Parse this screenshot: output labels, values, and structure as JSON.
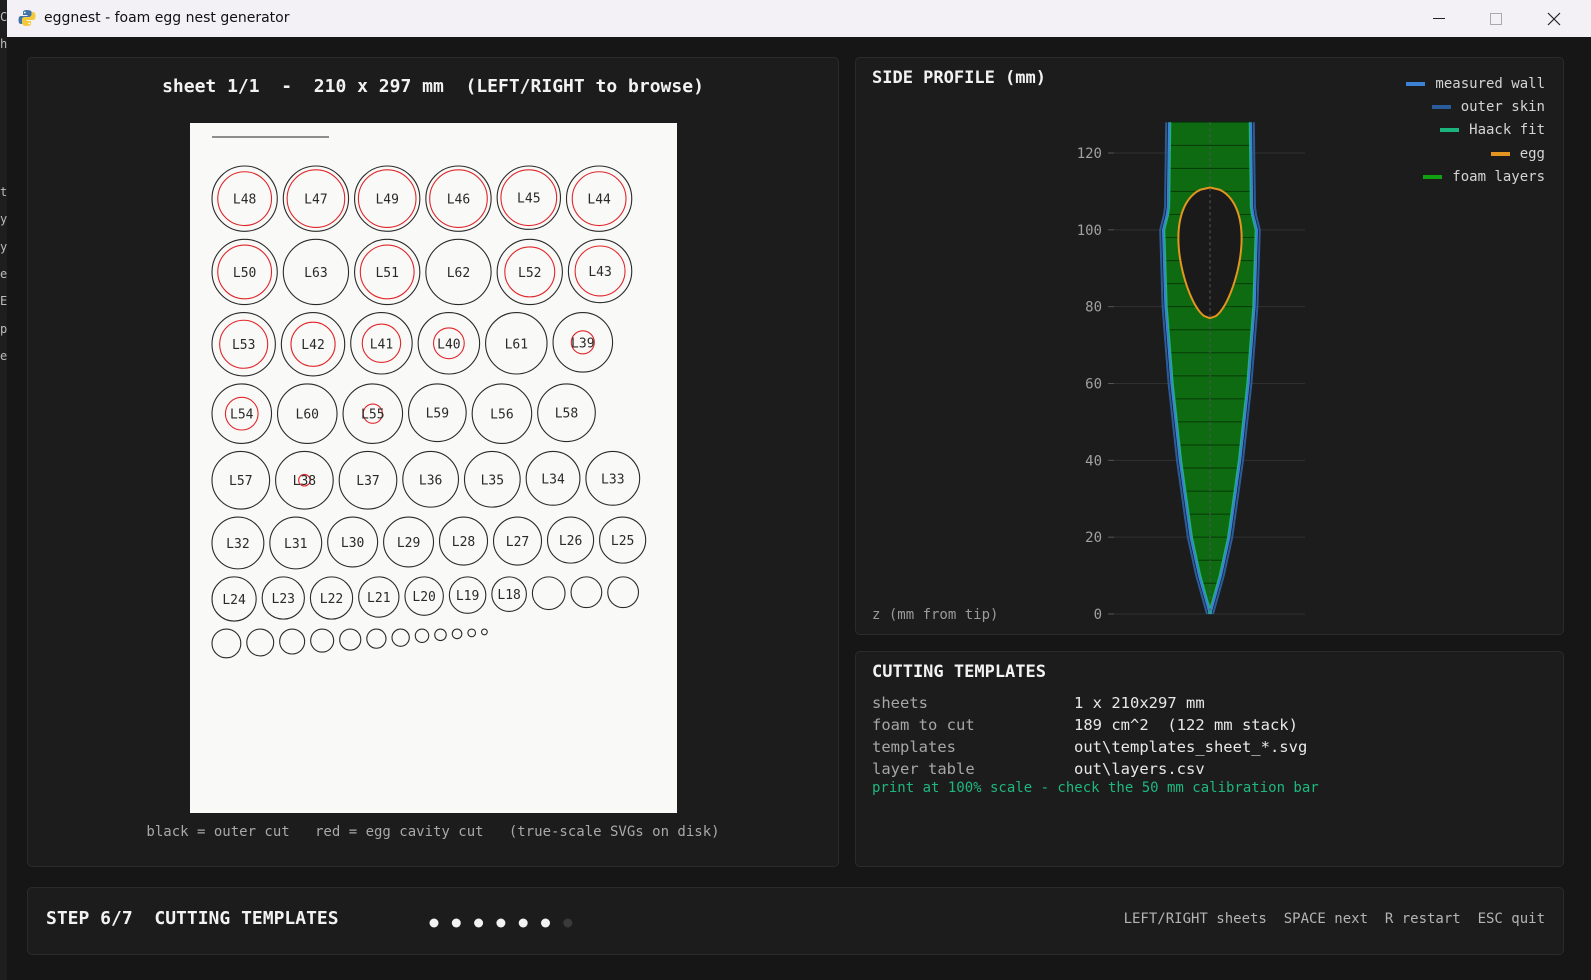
{
  "window": {
    "title": "eggnest - foam egg nest generator",
    "side_fragments": [
      "C",
      "h",
      "t.",
      "y",
      "y",
      "e",
      "E",
      "p",
      "e"
    ]
  },
  "sheet_panel": {
    "title": "sheet 1/1  -  210 x 297 mm  (LEFT/RIGHT to browse)",
    "caption": "black = outer cut   red = egg cavity cut   (true-scale SVGs on disk)",
    "layers": [
      {
        "label": "L48",
        "outer_d": 34,
        "cavity_d": 28
      },
      {
        "label": "L47",
        "outer_d": 34,
        "cavity_d": 30
      },
      {
        "label": "L49",
        "outer_d": 34,
        "cavity_d": 30
      },
      {
        "label": "L46",
        "outer_d": 34,
        "cavity_d": 30
      },
      {
        "label": "L45",
        "outer_d": 33,
        "cavity_d": 29
      },
      {
        "label": "L44",
        "outer_d": 34,
        "cavity_d": 28
      },
      {
        "label": "L50",
        "outer_d": 34,
        "cavity_d": 28
      },
      {
        "label": "L63",
        "outer_d": 34,
        "cavity_d": 0
      },
      {
        "label": "L51",
        "outer_d": 34,
        "cavity_d": 28
      },
      {
        "label": "L62",
        "outer_d": 34,
        "cavity_d": 0
      },
      {
        "label": "L52",
        "outer_d": 34,
        "cavity_d": 26
      },
      {
        "label": "L43",
        "outer_d": 33,
        "cavity_d": 26
      },
      {
        "label": "L53",
        "outer_d": 33,
        "cavity_d": 25
      },
      {
        "label": "L42",
        "outer_d": 33,
        "cavity_d": 23
      },
      {
        "label": "L41",
        "outer_d": 32,
        "cavity_d": 20
      },
      {
        "label": "L40",
        "outer_d": 32,
        "cavity_d": 16
      },
      {
        "label": "L61",
        "outer_d": 32,
        "cavity_d": 0
      },
      {
        "label": "L39",
        "outer_d": 31,
        "cavity_d": 12
      },
      {
        "label": "L54",
        "outer_d": 31,
        "cavity_d": 17
      },
      {
        "label": "L60",
        "outer_d": 31,
        "cavity_d": 0
      },
      {
        "label": "L55",
        "outer_d": 31,
        "cavity_d": 10
      },
      {
        "label": "L59",
        "outer_d": 30,
        "cavity_d": 0
      },
      {
        "label": "L56",
        "outer_d": 31,
        "cavity_d": 0
      },
      {
        "label": "L58",
        "outer_d": 30,
        "cavity_d": 0
      },
      {
        "label": "L57",
        "outer_d": 30,
        "cavity_d": 0
      },
      {
        "label": "L38",
        "outer_d": 30,
        "cavity_d": 6
      },
      {
        "label": "L37",
        "outer_d": 30,
        "cavity_d": 0
      },
      {
        "label": "L36",
        "outer_d": 29,
        "cavity_d": 0
      },
      {
        "label": "L35",
        "outer_d": 29,
        "cavity_d": 0
      },
      {
        "label": "L34",
        "outer_d": 28,
        "cavity_d": 0
      },
      {
        "label": "L33",
        "outer_d": 28,
        "cavity_d": 0
      },
      {
        "label": "L32",
        "outer_d": 27,
        "cavity_d": 0
      },
      {
        "label": "L31",
        "outer_d": 27,
        "cavity_d": 0
      },
      {
        "label": "L30",
        "outer_d": 26,
        "cavity_d": 0
      },
      {
        "label": "L29",
        "outer_d": 26,
        "cavity_d": 0
      },
      {
        "label": "L28",
        "outer_d": 25,
        "cavity_d": 0
      },
      {
        "label": "L27",
        "outer_d": 25,
        "cavity_d": 0
      },
      {
        "label": "L26",
        "outer_d": 24,
        "cavity_d": 0
      },
      {
        "label": "L25",
        "outer_d": 24,
        "cavity_d": 0
      },
      {
        "label": "L24",
        "outer_d": 23,
        "cavity_d": 0
      },
      {
        "label": "L23",
        "outer_d": 22,
        "cavity_d": 0
      },
      {
        "label": "L22",
        "outer_d": 22,
        "cavity_d": 0
      },
      {
        "label": "L21",
        "outer_d": 21,
        "cavity_d": 0
      },
      {
        "label": "L20",
        "outer_d": 20,
        "cavity_d": 0
      },
      {
        "label": "L19",
        "outer_d": 19,
        "cavity_d": 0
      },
      {
        "label": "L18",
        "outer_d": 18,
        "cavity_d": 0
      },
      {
        "label": "",
        "outer_d": 17,
        "cavity_d": 0
      },
      {
        "label": "",
        "outer_d": 16,
        "cavity_d": 0
      },
      {
        "label": "",
        "outer_d": 16,
        "cavity_d": 0
      },
      {
        "label": "",
        "outer_d": 15,
        "cavity_d": 0
      },
      {
        "label": "",
        "outer_d": 14,
        "cavity_d": 0
      },
      {
        "label": "",
        "outer_d": 13,
        "cavity_d": 0
      },
      {
        "label": "",
        "outer_d": 12,
        "cavity_d": 0
      },
      {
        "label": "",
        "outer_d": 11,
        "cavity_d": 0
      },
      {
        "label": "",
        "outer_d": 10,
        "cavity_d": 0
      },
      {
        "label": "",
        "outer_d": 9,
        "cavity_d": 0
      },
      {
        "label": "",
        "outer_d": 7,
        "cavity_d": 0
      },
      {
        "label": "",
        "outer_d": 6,
        "cavity_d": 0
      },
      {
        "label": "",
        "outer_d": 5,
        "cavity_d": 0
      },
      {
        "label": "",
        "outer_d": 4,
        "cavity_d": 0
      },
      {
        "label": "",
        "outer_d": 3,
        "cavity_d": 0
      }
    ]
  },
  "profile_panel": {
    "title": "SIDE PROFILE (mm)",
    "z_label": "z (mm from tip)",
    "legend": [
      {
        "label": "measured wall",
        "color": "#3b82d6"
      },
      {
        "label": "outer skin",
        "color": "#2a5b9a"
      },
      {
        "label": "Haack fit",
        "color": "#1bb37e"
      },
      {
        "label": "egg",
        "color": "#e39520"
      },
      {
        "label": "foam layers",
        "color": "#12a012"
      }
    ]
  },
  "chart_data": {
    "type": "area",
    "title": "SIDE PROFILE (mm)",
    "ylabel": "z (mm from tip)",
    "ylim": [
      0,
      128
    ],
    "yticks": [
      0,
      20,
      40,
      60,
      80,
      100,
      120
    ],
    "grid": true,
    "legend_position": "top-right",
    "wall_half_width_mm": [
      {
        "z": 0,
        "r": 0
      },
      {
        "z": 10,
        "r": 4.5
      },
      {
        "z": 20,
        "r": 8
      },
      {
        "z": 40,
        "r": 12.5
      },
      {
        "z": 60,
        "r": 16
      },
      {
        "z": 80,
        "r": 18.5
      },
      {
        "z": 100,
        "r": 19.5
      },
      {
        "z": 105,
        "r": 17.5
      },
      {
        "z": 128,
        "r": 17
      }
    ],
    "egg": {
      "z_bottom": 77,
      "z_top": 111,
      "max_half_width_mm": 16
    }
  },
  "templates_panel": {
    "title": "CUTTING TEMPLATES",
    "rows": [
      {
        "key": "sheets",
        "value": "1 x 210x297 mm"
      },
      {
        "key": "foam to cut",
        "value": "189 cm^2  (122 mm stack)"
      },
      {
        "key": "templates",
        "value": "out\\templates_sheet_*.svg"
      },
      {
        "key": "layer table",
        "value": "out\\layers.csv"
      }
    ],
    "note": "print at 100% scale - check the 50 mm calibration bar"
  },
  "step_bar": {
    "title": "STEP 6/7  CUTTING TEMPLATES",
    "current_step": 6,
    "total_steps": 7,
    "keys": "LEFT/RIGHT sheets  SPACE next  R restart  ESC quit"
  }
}
